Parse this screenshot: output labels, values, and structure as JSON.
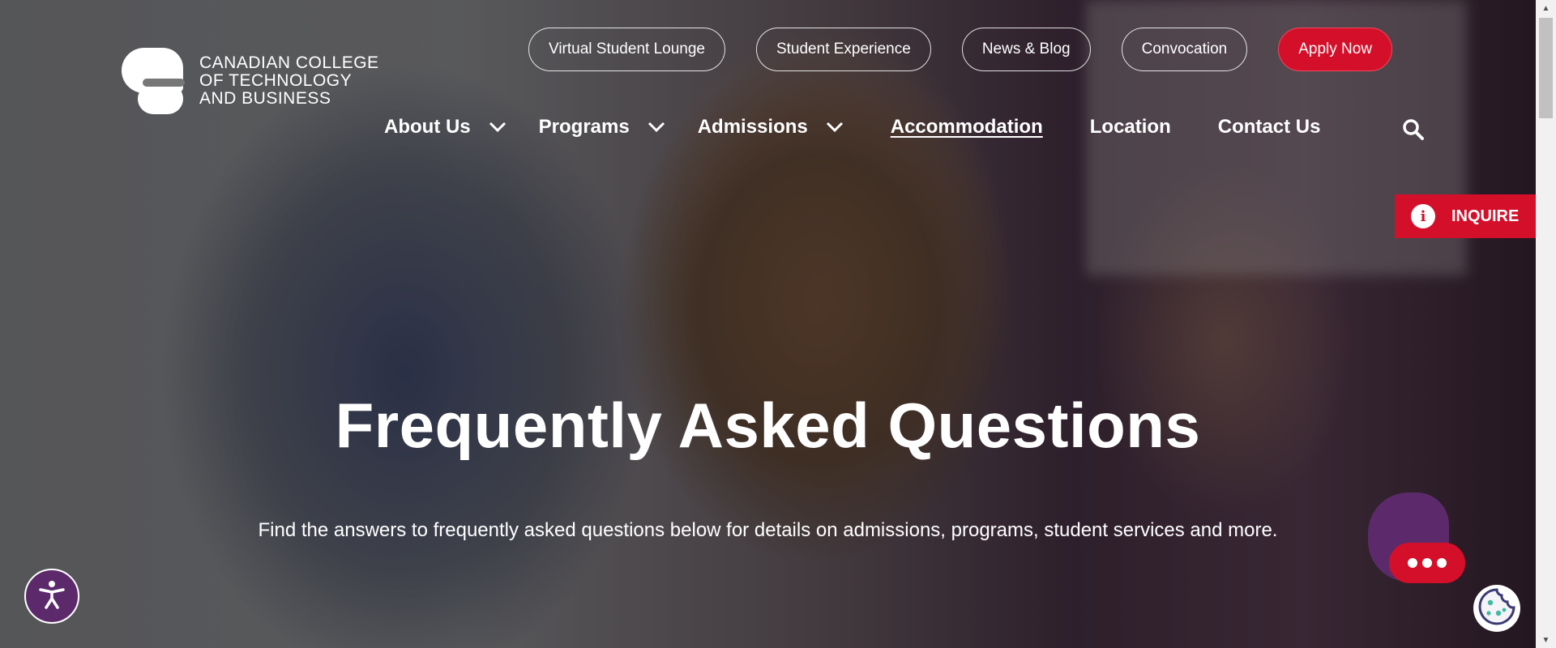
{
  "logo": {
    "lines": [
      "CANADIAN COLLEGE",
      "OF TECHNOLOGY",
      "AND BUSINESS"
    ]
  },
  "top_links": [
    {
      "label": "Virtual Student Lounge"
    },
    {
      "label": "Student Experience"
    },
    {
      "label": "News & Blog"
    },
    {
      "label": "Convocation"
    },
    {
      "label": "Apply Now"
    }
  ],
  "main_nav": [
    {
      "label": "About Us",
      "dropdown": true
    },
    {
      "label": "Programs",
      "dropdown": true
    },
    {
      "label": "Admissions",
      "dropdown": true
    },
    {
      "label": "Accommodation",
      "dropdown": false,
      "current": true
    },
    {
      "label": "Location",
      "dropdown": false
    },
    {
      "label": "Contact Us",
      "dropdown": false
    }
  ],
  "inquire": {
    "label": "INQUIRE"
  },
  "hero": {
    "title": "Frequently Asked Questions",
    "subtitle": "Find the answers to frequently asked questions below for details on admissions, programs, student services and more."
  },
  "icons": {
    "search": "search-icon",
    "chevron": "chevron-down-icon",
    "info": "info-icon",
    "accessibility": "accessibility-icon",
    "chat": "chat-icon",
    "cookie": "cookie-icon"
  },
  "colors": {
    "brand_red": "#d40f2a",
    "brand_purple": "#5c2a6b"
  }
}
